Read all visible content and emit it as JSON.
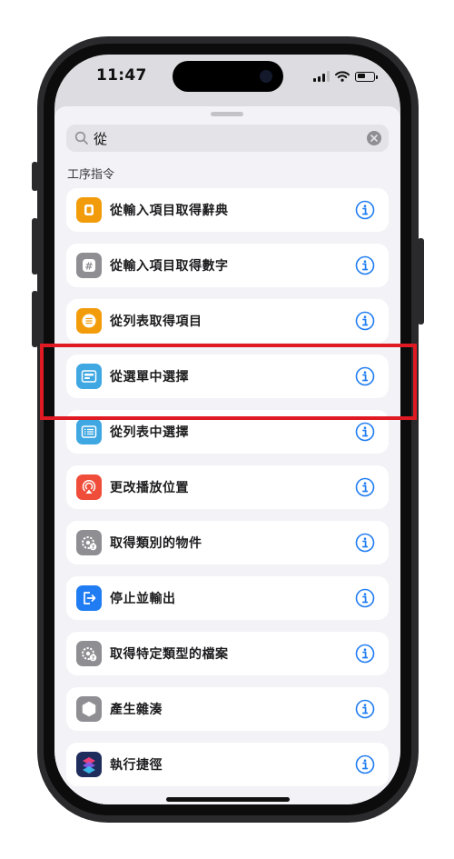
{
  "status_bar": {
    "time": "11:47"
  },
  "search": {
    "query": "從"
  },
  "section_header": "工序指令",
  "actions": [
    {
      "label": "從輸入項目取得辭典",
      "icon": "dictionary-icon",
      "color": "#f29c0c"
    },
    {
      "label": "從輸入項目取得數字",
      "icon": "number-icon",
      "color": "#8e8e93"
    },
    {
      "label": "從列表取得項目",
      "icon": "list-icon",
      "color": "#f29c0c"
    },
    {
      "label": "從選單中選擇",
      "icon": "menu-icon",
      "color": "#3fa7e1"
    },
    {
      "label": "從列表中選擇",
      "icon": "list-choose-icon",
      "color": "#3fa7e1"
    },
    {
      "label": "更改播放位置",
      "icon": "airplay-icon",
      "color": "#ef4c3a"
    },
    {
      "label": "取得類別的物件",
      "icon": "gear-badge-icon",
      "color": "#8e8e93"
    },
    {
      "label": "停止並輸出",
      "icon": "exit-icon",
      "color": "#1f7cf2"
    },
    {
      "label": "取得特定類型的檔案",
      "icon": "gear-badge-icon",
      "color": "#8e8e93"
    },
    {
      "label": "產生雜湊",
      "icon": "hexagon-icon",
      "color": "#8e8e93"
    },
    {
      "label": "執行捷徑",
      "icon": "shortcuts-icon",
      "color": "#1f2d5c"
    }
  ],
  "highlight_color": "#e01a22",
  "info_color": "#1f7cf2"
}
